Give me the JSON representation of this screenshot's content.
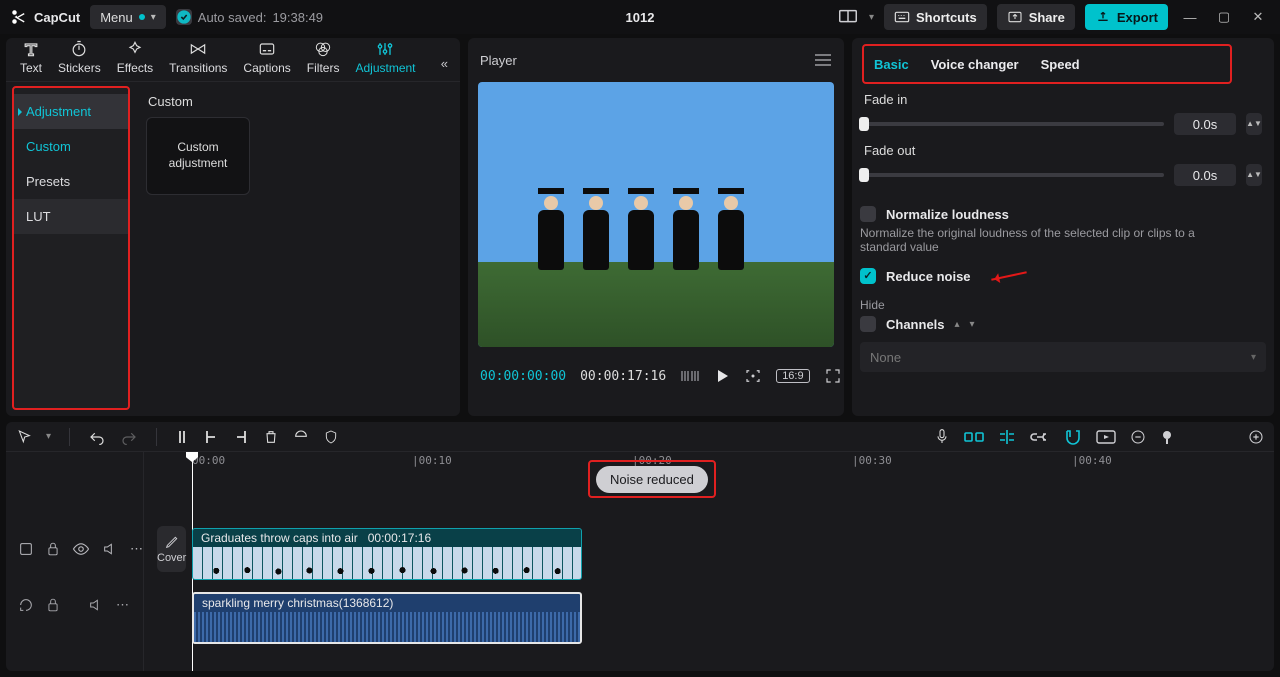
{
  "app": {
    "name": "CapCut"
  },
  "menu_label": "Menu",
  "autosave": {
    "prefix": "Auto saved:",
    "time": "19:38:49"
  },
  "project_title": "1012",
  "topbar": {
    "shortcuts": "Shortcuts",
    "share": "Share",
    "export": "Export"
  },
  "tool_tabs": [
    "Text",
    "Stickers",
    "Effects",
    "Transitions",
    "Captions",
    "Filters",
    "Adjustment"
  ],
  "active_tool_tab": "Adjustment",
  "sidenav": {
    "header": "Adjustment",
    "items": [
      "Custom",
      "Presets",
      "LUT"
    ],
    "selected": "Custom"
  },
  "left": {
    "section_title": "Custom",
    "card_label": "Custom adjustment"
  },
  "player": {
    "title": "Player",
    "current": "00:00:00:00",
    "duration": "00:00:17:16",
    "ratio": "16:9"
  },
  "inspector": {
    "tabs": [
      "Basic",
      "Voice changer",
      "Speed"
    ],
    "active": "Basic",
    "fade_in": {
      "label": "Fade in",
      "value": "0.0s"
    },
    "fade_out": {
      "label": "Fade out",
      "value": "0.0s"
    },
    "normalize": {
      "label": "Normalize loudness",
      "desc": "Normalize the original loudness of the selected clip or clips to a standard value",
      "checked": false
    },
    "reduce_noise": {
      "label": "Reduce noise",
      "checked": true
    },
    "hide_label": "Hide",
    "channels": {
      "label": "Channels"
    },
    "dropdown_placeholder": "None"
  },
  "timeline": {
    "cover_label": "Cover",
    "ruler": [
      "00:00",
      "|00:10",
      "|00:20",
      "|00:30",
      "|00:40"
    ],
    "video_clip": {
      "name": "Graduates throw caps into air",
      "dur": "00:00:17:16"
    },
    "audio_clip": {
      "name": "sparkling merry christmas(1368612)"
    },
    "toast": "Noise reduced"
  }
}
